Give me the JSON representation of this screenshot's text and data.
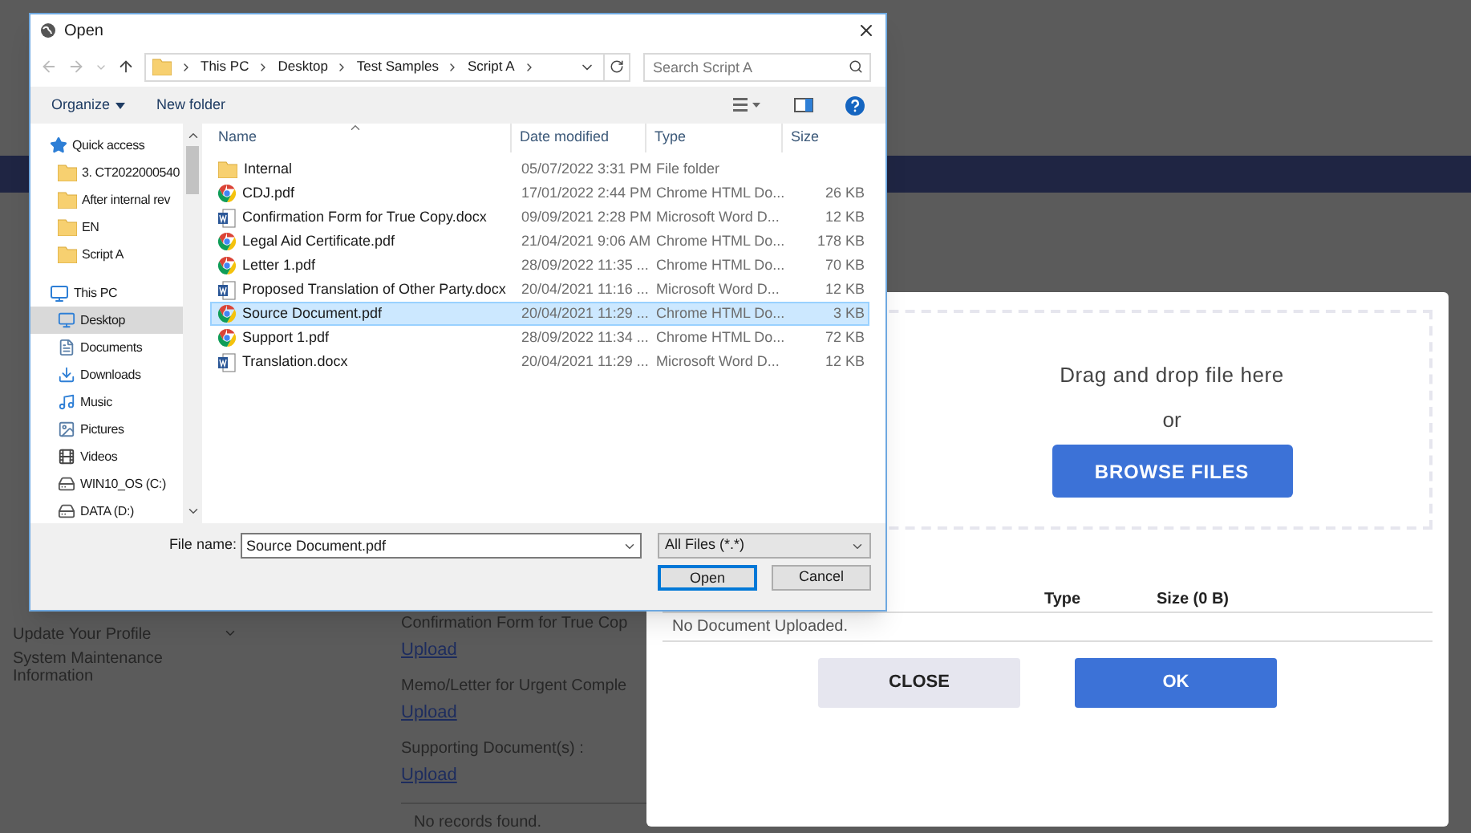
{
  "background_page": {
    "sidebar": [
      {
        "label": "Update Your Profile",
        "has_submenu": true
      },
      {
        "label": "System Maintenance Information",
        "has_submenu": false
      }
    ],
    "sections": [
      {
        "label": "Confirmation Form for True Cop",
        "link": "Upload"
      },
      {
        "label": "Memo/Letter for Urgent Comple",
        "link": "Upload"
      },
      {
        "label": "Supporting Document(s) :",
        "link": "Upload"
      }
    ],
    "empty_text": "No records found."
  },
  "file_dialog": {
    "title": "Open",
    "breadcrumb": [
      "This PC",
      "Desktop",
      "Test Samples",
      "Script A"
    ],
    "search": {
      "placeholder": "Search Script A"
    },
    "toolbar": [
      {
        "label": "Organize",
        "dropdown": true
      },
      {
        "label": "New folder",
        "dropdown": false
      }
    ],
    "nav": [
      {
        "label": "Quick access",
        "kind": "star",
        "selected": false,
        "children": [
          {
            "label": "3. CT2022000540",
            "kind": "folder",
            "selected": false
          },
          {
            "label": "After internal rev",
            "kind": "folder",
            "selected": false
          },
          {
            "label": "EN",
            "kind": "folder",
            "selected": false
          },
          {
            "label": "Script A",
            "kind": "folder",
            "selected": false
          }
        ]
      },
      {
        "label": "This PC",
        "kind": "pc",
        "selected": false,
        "children": [
          {
            "label": "Desktop",
            "kind": "desktop",
            "selected": true
          },
          {
            "label": "Documents",
            "kind": "documents",
            "selected": false
          },
          {
            "label": "Downloads",
            "kind": "downloads",
            "selected": false
          },
          {
            "label": "Music",
            "kind": "music",
            "selected": false
          },
          {
            "label": "Pictures",
            "kind": "pictures",
            "selected": false
          },
          {
            "label": "Videos",
            "kind": "videos",
            "selected": false
          },
          {
            "label": "WIN10_OS (C:)",
            "kind": "drive",
            "selected": false
          },
          {
            "label": "DATA (D:)",
            "kind": "drive",
            "selected": false
          }
        ]
      }
    ],
    "columns": [
      "Name",
      "Date modified",
      "Type",
      "Size"
    ],
    "files": [
      {
        "kind": "folder",
        "name": "Internal",
        "date": "05/07/2022 3:31 PM",
        "type": "File folder",
        "selected": false
      },
      {
        "kind": "web",
        "name": "CDJ.pdf",
        "date": "17/01/2022 2:44 PM",
        "type": "Chrome HTML Do...",
        "size": "26 KB",
        "selected": false
      },
      {
        "kind": "word",
        "name": "Confirmation Form for True Copy.docx",
        "date": "09/09/2021 2:28 PM",
        "type": "Microsoft Word D...",
        "size": "12 KB",
        "selected": false
      },
      {
        "kind": "web",
        "name": "Legal Aid Certificate.pdf",
        "date": "21/04/2021 9:06 AM",
        "type": "Chrome HTML Do...",
        "size": "178 KB",
        "selected": false
      },
      {
        "kind": "web",
        "name": "Letter 1.pdf",
        "date": "28/09/2022 11:35 ...",
        "type": "Chrome HTML Do...",
        "size": "70 KB",
        "selected": false
      },
      {
        "kind": "word",
        "name": "Proposed Translation of Other Party.docx",
        "date": "20/04/2021 11:16 ...",
        "type": "Microsoft Word D...",
        "size": "12 KB",
        "selected": false
      },
      {
        "kind": "web",
        "name": "Source Document.pdf",
        "date": "20/04/2021 11:29 ...",
        "type": "Chrome HTML Do...",
        "size": "3 KB",
        "selected": true
      },
      {
        "kind": "web",
        "name": "Support 1.pdf",
        "date": "28/09/2022 11:34 ...",
        "type": "Chrome HTML Do...",
        "size": "72 KB",
        "selected": false
      },
      {
        "kind": "word",
        "name": "Translation.docx",
        "date": "20/04/2021 11:29 ...",
        "type": "Microsoft Word D...",
        "size": "12 KB",
        "selected": false
      }
    ],
    "file_name_label": "File name:",
    "file_name": "Source Document.pdf",
    "filter": "All Files (*.*)",
    "buttons": [
      "Open",
      "Cancel"
    ]
  },
  "upload_modal": {
    "drop_text": "Drag and drop file here",
    "or_text": "or",
    "browse_button": "BROWSE FILES",
    "table": {
      "columns": [
        "Type",
        "Size (0 B)"
      ],
      "empty_text": "No Document Uploaded."
    },
    "buttons": [
      {
        "label": "CLOSE",
        "kind": "secondary"
      },
      {
        "label": "OK",
        "kind": "primary"
      }
    ]
  }
}
